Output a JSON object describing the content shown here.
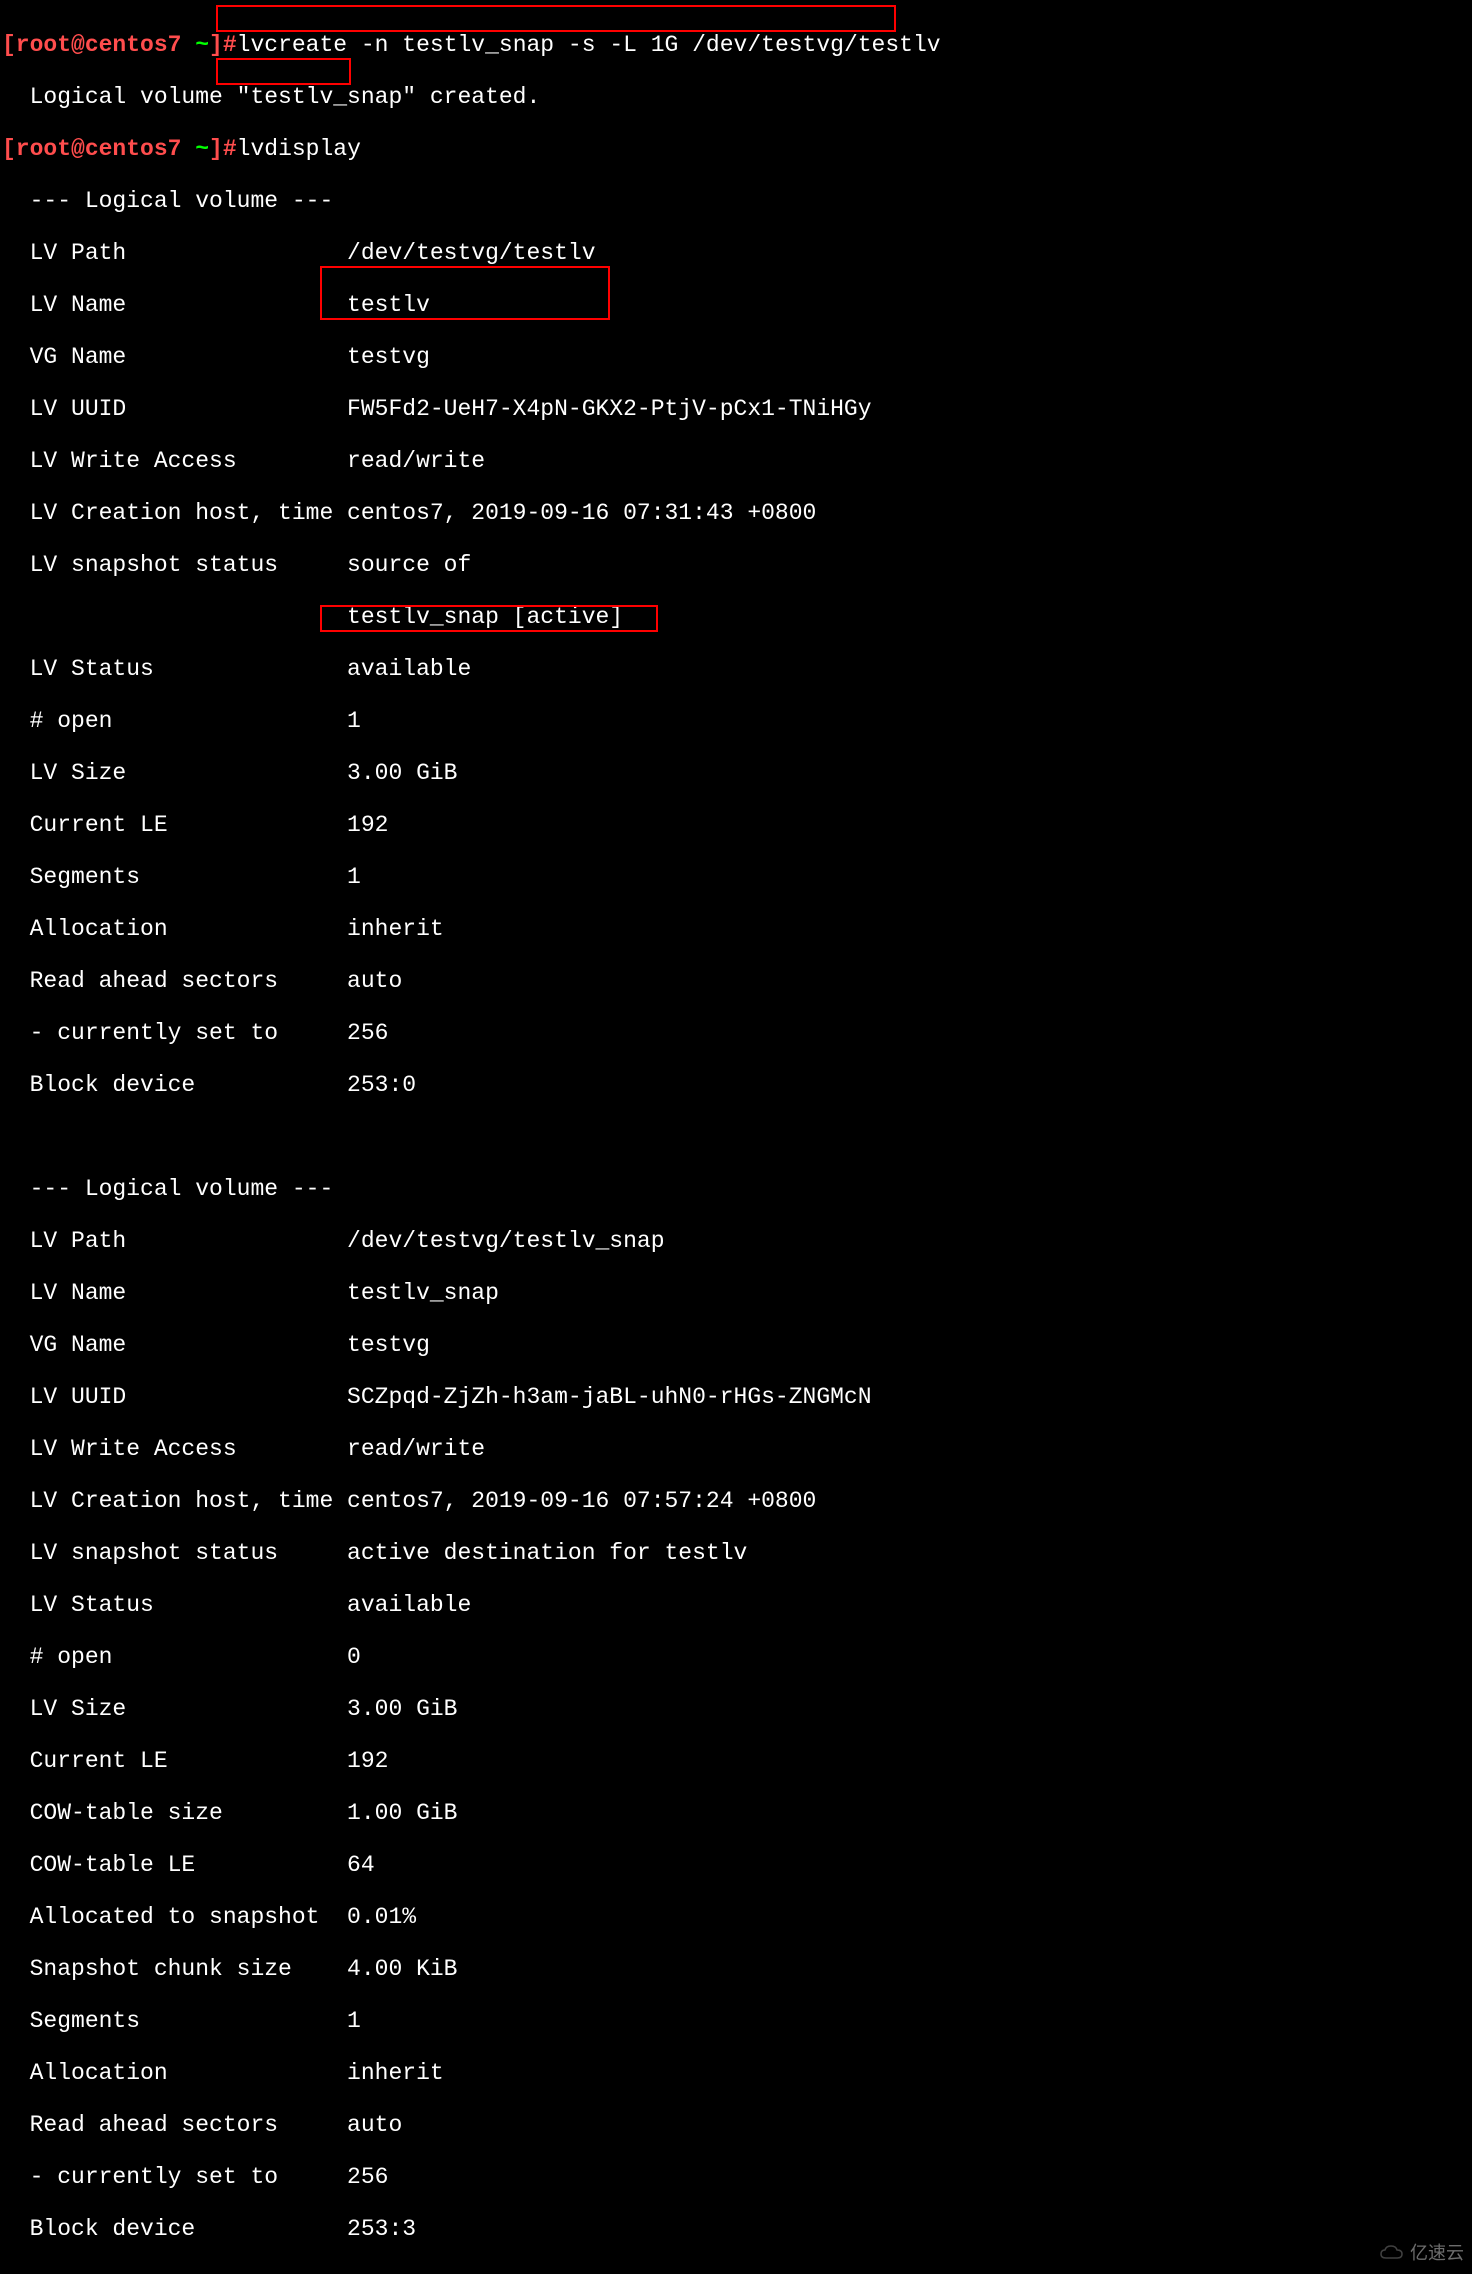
{
  "prompt1": {
    "user": "[root@centos7 ",
    "dir": "~",
    "end": "]#",
    "cmd": "lvcreate -n testlv_snap -s -L 1G /dev/testvg/testlv"
  },
  "created_msg": "  Logical volume \"testlv_snap\" created.",
  "prompt2": {
    "user": "[root@centos7 ",
    "dir": "~",
    "end": "]#",
    "cmd": "lvdisplay"
  },
  "lv1": {
    "header": "  --- Logical volume ---",
    "path": "  LV Path                /dev/testvg/testlv",
    "name": "  LV Name                testlv",
    "vg": "  VG Name                testvg",
    "uuid": "  LV UUID                FW5Fd2-UeH7-X4pN-GKX2-PtjV-pCx1-TNiHGy",
    "wa": "  LV Write Access        read/write",
    "ctime": "  LV Creation host, time centos7, 2019-09-16 07:31:43 +0800",
    "snap1": "  LV snapshot status     source of",
    "snap2": "                         testlv_snap [active]",
    "status": "  LV Status              available",
    "open": "  # open                 1",
    "size": "  LV Size                3.00 GiB",
    "le": "  Current LE             192",
    "seg": "  Segments               1",
    "alloc": "  Allocation             inherit",
    "rahead": "  Read ahead sectors     auto",
    "rset": "  - currently set to     256",
    "bdev": "  Block device           253:0"
  },
  "blank": "   ",
  "lv2": {
    "header": "  --- Logical volume ---",
    "path": "  LV Path                /dev/testvg/testlv_snap",
    "name": "  LV Name                testlv_snap",
    "vg": "  VG Name                testvg",
    "uuid": "  LV UUID                SCZpqd-ZjZh-h3am-jaBL-uhN0-rHGs-ZNGMcN",
    "wa": "  LV Write Access        read/write",
    "ctime": "  LV Creation host, time centos7, 2019-09-16 07:57:24 +0800",
    "snap": "  LV snapshot status     active destination for testlv",
    "status": "  LV Status              available",
    "open": "  # open                 0",
    "size": "  LV Size                3.00 GiB",
    "le": "  Current LE             192",
    "cowsize": "  COW-table size         1.00 GiB",
    "cowle": "  COW-table LE           64",
    "allocsnap": "  Allocated to snapshot  0.01%",
    "chunk": "  Snapshot chunk size    4.00 KiB",
    "seg": "  Segments               1",
    "alloc": "  Allocation             inherit",
    "rahead": "  Read ahead sectors     auto",
    "rset": "  - currently set to     256",
    "bdev": "  Block device           253:3"
  },
  "watermark": "亿速云"
}
